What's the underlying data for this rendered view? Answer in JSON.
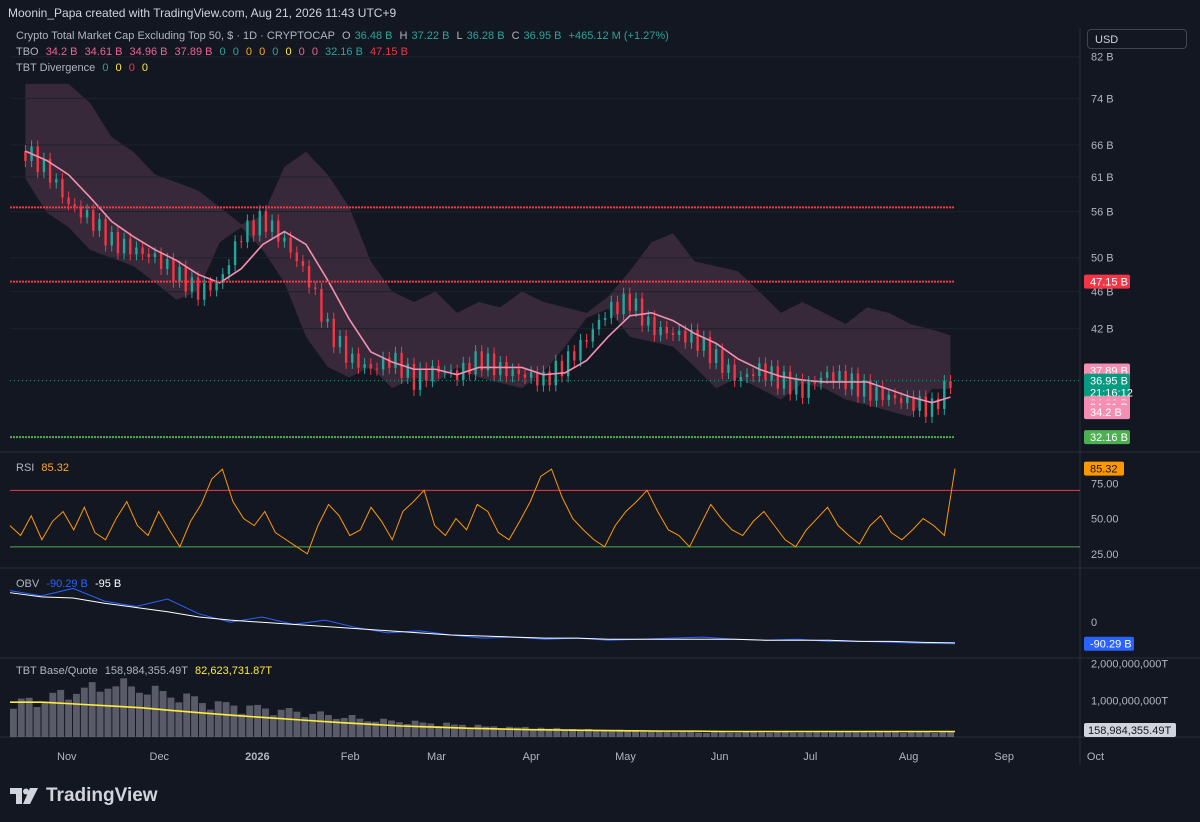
{
  "header": {
    "credit": "Moonin_Papa created with TradingView.com, Aug 21, 2026 11:43 UTC+9",
    "symbol": "Crypto Total Market Cap Excluding Top 50, $ · 1D · CRYPTOCAP",
    "ohlc": {
      "o_label": "O",
      "o": "36.48 B",
      "h_label": "H",
      "h": "37.22 B",
      "l_label": "L",
      "l": "36.28 B",
      "c_label": "C",
      "c": "36.95 B",
      "change": "+465.12 M (+1.27%)"
    },
    "tbo_row": {
      "label": "TBO",
      "values": [
        "34.2 B",
        "34.61 B",
        "34.96 B",
        "37.89 B",
        "0",
        "0",
        "0",
        "0",
        "0",
        "0",
        "0",
        "0",
        "32.16 B",
        "47.15 B"
      ]
    },
    "divergence_row": {
      "label": "TBT Divergence",
      "values": [
        "0",
        "0",
        "0",
        "0"
      ]
    },
    "currency": "USD"
  },
  "colors": {
    "background": "#131722",
    "up": "#26a69a",
    "down": "#f23645",
    "ma_pink": "#f48fb1",
    "ma_cyan": "#80deea",
    "rsi": "#ff9800",
    "obv": "#2962ff",
    "obv_signal": "#ffffff",
    "volume_ma": "#ffeb3b"
  },
  "chart_data": [
    {
      "type": "line",
      "title": "Crypto Total Market Cap Excluding Top 50, $ · 1D · CRYPTOCAP",
      "price_scale": "log",
      "x_ticks": [
        "Nov",
        "Dec",
        "2026",
        "Feb",
        "Mar",
        "Apr",
        "May",
        "Jun",
        "Jul",
        "Aug",
        "Sep",
        "Oct"
      ],
      "y_ticks": [
        "82 B",
        "74 B",
        "66 B",
        "61 B",
        "56 B",
        "50 B",
        "46 B",
        "42 B"
      ],
      "series": [
        {
          "name": "Close",
          "x": [
            "2025-10-25",
            "2025-11-01",
            "2025-11-08",
            "2025-11-15",
            "2025-11-22",
            "2025-11-29",
            "2025-12-06",
            "2025-12-13",
            "2025-12-20",
            "2025-12-27",
            "2026-01-03",
            "2026-01-10",
            "2026-01-17",
            "2026-01-24",
            "2026-01-31",
            "2026-02-07",
            "2026-02-14",
            "2026-02-21",
            "2026-02-28",
            "2026-03-07",
            "2026-03-14",
            "2026-03-21",
            "2026-03-28",
            "2026-04-04",
            "2026-04-11",
            "2026-04-18",
            "2026-04-25",
            "2026-05-02",
            "2026-05-09",
            "2026-05-16",
            "2026-05-23",
            "2026-05-30",
            "2026-06-06",
            "2026-06-13",
            "2026-06-20",
            "2026-06-27",
            "2026-07-04",
            "2026-07-11",
            "2026-07-18",
            "2026-07-25",
            "2026-08-01",
            "2026-08-08",
            "2026-08-15",
            "2026-08-21"
          ],
          "values": [
            65,
            62,
            57,
            55,
            52,
            51,
            50,
            48,
            46,
            47,
            53,
            55,
            52,
            48,
            42,
            39,
            38,
            39,
            37,
            38,
            37.5,
            39,
            38,
            37.5,
            37,
            38.5,
            41,
            44,
            45,
            42,
            41.5,
            41,
            39,
            37,
            38,
            37,
            36,
            37.5,
            37,
            36,
            35.5,
            35,
            34.5,
            36.95
          ]
        }
      ],
      "levels": [
        {
          "name": "resistance",
          "value": 56.6
        },
        {
          "name": "resistance",
          "value": 47.15
        },
        {
          "name": "support",
          "value": 32.16
        }
      ],
      "price_labels": [
        {
          "text": "47.15 B",
          "value": 47.15,
          "color": "#f23645"
        },
        {
          "text": "37.89 B",
          "value": 37.89,
          "color": "#f48fb1"
        },
        {
          "text": "36.95 B",
          "value": 36.95,
          "color": "#089981",
          "sub": "21:16:12"
        },
        {
          "text": "34.96 B",
          "value": 34.96,
          "color": "#f48fb1"
        },
        {
          "text": "34.61 B",
          "value": 34.61,
          "color": "#f48fb1"
        },
        {
          "text": "34.2 B",
          "value": 34.2,
          "color": "#f48fb1"
        },
        {
          "text": "32.16 B",
          "value": 32.16,
          "color": "#4caf50"
        }
      ]
    },
    {
      "type": "line",
      "title": "RSI",
      "last_value": "85.32",
      "y_ticks": [
        "75.00",
        "50.00",
        "25.00"
      ],
      "bands": {
        "upper": 70,
        "lower": 30
      },
      "ylim": [
        15,
        95
      ],
      "series": [
        {
          "name": "RSI",
          "values": [
            45,
            38,
            52,
            35,
            48,
            55,
            42,
            58,
            40,
            35,
            50,
            62,
            45,
            38,
            55,
            42,
            30,
            48,
            60,
            78,
            85,
            62,
            50,
            45,
            55,
            40,
            35,
            30,
            25,
            45,
            60,
            52,
            38,
            42,
            58,
            48,
            35,
            55,
            62,
            70,
            45,
            38,
            50,
            42,
            60,
            55,
            40,
            35,
            48,
            62,
            80,
            85,
            65,
            50,
            42,
            35,
            30,
            45,
            55,
            62,
            70,
            55,
            42,
            38,
            30,
            45,
            60,
            50,
            42,
            38,
            48,
            55,
            45,
            35,
            30,
            42,
            50,
            58,
            45,
            38,
            32,
            45,
            52,
            40,
            35,
            42,
            50,
            45,
            38,
            85.32
          ]
        }
      ]
    },
    {
      "type": "line",
      "title": "OBV",
      "y_ticks": [
        "0"
      ],
      "series": [
        {
          "name": "OBV",
          "last_label": "-90.29 B",
          "values": [
            -40,
            -45,
            -38,
            -50,
            -55,
            -48,
            -62,
            -70,
            -65,
            -72,
            -68,
            -75,
            -80,
            -78,
            -82,
            -85,
            -84,
            -86,
            -85,
            -87,
            -86,
            -85,
            -84,
            -86,
            -87,
            -86,
            -88,
            -88,
            -89,
            -90,
            -90.29
          ]
        },
        {
          "name": "Signal",
          "last_label": "-95 B",
          "values": [
            -42,
            -46,
            -47,
            -52,
            -56,
            -60,
            -65,
            -68,
            -70,
            -72,
            -74,
            -76,
            -78,
            -80,
            -82,
            -83,
            -84,
            -85,
            -85,
            -86,
            -86,
            -86,
            -86,
            -86,
            -87,
            -87,
            -87,
            -88,
            -88,
            -89,
            -89.5
          ]
        }
      ]
    },
    {
      "type": "bar",
      "title": "TBT Base/Quote",
      "header_values": [
        "158,984,355.49T",
        "82,623,731.87T"
      ],
      "y_ticks": [
        "2,000,000,000T",
        "1,000,000,000T"
      ],
      "last_label": "158,984,355.49T",
      "series": [
        {
          "name": "Volume",
          "values": [
            1.1,
            1.3,
            1.5,
            1.6,
            1.4,
            1.2,
            1.0,
            0.9,
            0.8,
            0.7,
            0.6,
            0.5,
            0.45,
            0.4,
            0.35,
            0.3,
            0.28,
            0.25,
            0.22,
            0.2,
            0.18,
            0.17,
            0.16,
            0.16,
            0.15,
            0.15,
            0.16,
            0.16,
            0.15,
            0.16
          ]
        },
        {
          "name": "MA",
          "values": [
            0.95,
            0.95,
            0.9,
            0.85,
            0.8,
            0.72,
            0.65,
            0.58,
            0.52,
            0.46,
            0.4,
            0.35,
            0.3,
            0.27,
            0.24,
            0.22,
            0.2,
            0.19,
            0.18,
            0.17,
            0.16,
            0.16,
            0.15,
            0.15,
            0.15,
            0.15,
            0.15,
            0.15,
            0.15,
            0.15
          ]
        }
      ]
    }
  ],
  "footer": {
    "brand": "TradingView"
  }
}
